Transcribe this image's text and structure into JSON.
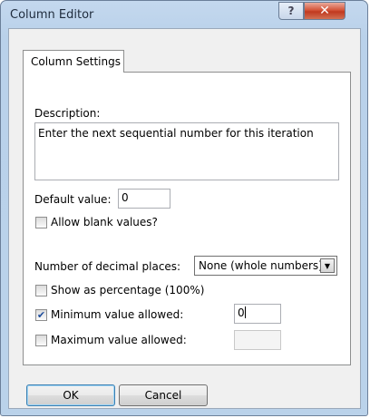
{
  "window": {
    "title": "Column Editor",
    "help_glyph": "?",
    "close_glyph": "✕"
  },
  "tabs": [
    {
      "label": "Column Settings"
    }
  ],
  "form": {
    "description_label": "Description:",
    "description_value": "Enter the next sequential number for this iteration",
    "default_value_label": "Default value:",
    "default_value": "0",
    "allow_blank_label": "Allow blank values?",
    "allow_blank_checked": false,
    "decimal_places_label": "Number of decimal places:",
    "decimal_places_value": "None (whole numbers)",
    "show_percentage_label": "Show as percentage (100%)",
    "show_percentage_checked": false,
    "min_value_label": "Minimum value allowed:",
    "min_value_checked": true,
    "min_value": "0",
    "max_value_label": "Maximum value allowed:",
    "max_value_checked": false,
    "max_value": ""
  },
  "buttons": {
    "ok": "OK",
    "cancel": "Cancel"
  },
  "check_glyph": "✔",
  "dropdown_glyph": "▼"
}
